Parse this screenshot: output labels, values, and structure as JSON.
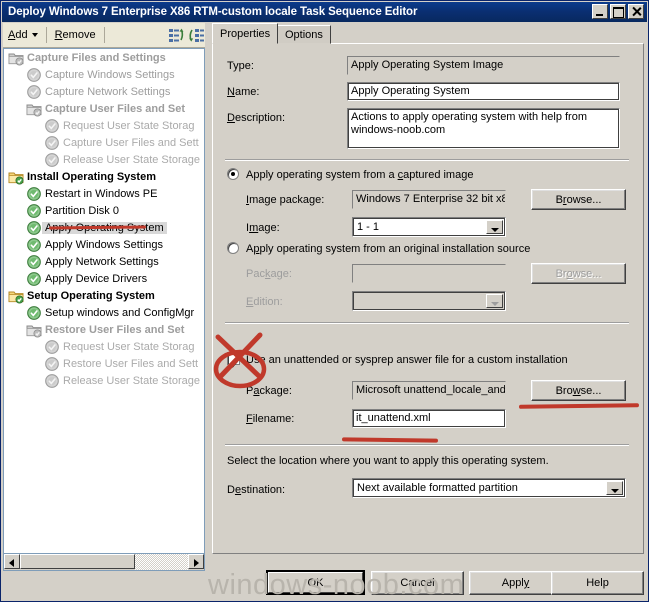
{
  "window": {
    "title": "Deploy Windows 7 Enterprise X86 RTM-custom locale Task Sequence Editor",
    "minimize_label": "Minimize",
    "maximize_label": "Maximize",
    "close_label": "Close"
  },
  "toolbar": {
    "add_label": "Add",
    "remove_label": "Remove",
    "move_up_icon": "move-up-icon",
    "move_down_icon": "move-down-icon"
  },
  "tree": {
    "items": [
      {
        "label": "Capture Files and Settings",
        "indent": 0,
        "icon": "folder-gray-icon",
        "style": "bold dim"
      },
      {
        "label": "Capture Windows Settings",
        "indent": 1,
        "icon": "step-gray-icon",
        "style": "dim"
      },
      {
        "label": "Capture Network Settings",
        "indent": 1,
        "icon": "step-gray-icon",
        "style": "dim"
      },
      {
        "label": "Capture User Files and Set",
        "indent": 1,
        "icon": "folder-gray-icon",
        "style": "bold dim"
      },
      {
        "label": "Request User State Storag",
        "indent": 2,
        "icon": "step-gray-icon",
        "style": "dim2"
      },
      {
        "label": "Capture User Files and Sett",
        "indent": 2,
        "icon": "step-gray-icon",
        "style": "dim2"
      },
      {
        "label": "Release User State Storage",
        "indent": 2,
        "icon": "step-gray-icon",
        "style": "dim2"
      },
      {
        "label": "Install Operating System",
        "indent": 0,
        "icon": "folder-yellow-icon",
        "style": "bold"
      },
      {
        "label": "Restart in Windows PE",
        "indent": 1,
        "icon": "step-green-icon",
        "style": ""
      },
      {
        "label": "Partition Disk 0",
        "indent": 1,
        "icon": "step-green-icon",
        "style": ""
      },
      {
        "label": "Apply Operating System",
        "indent": 1,
        "icon": "step-green-icon",
        "style": "sel"
      },
      {
        "label": "Apply Windows Settings",
        "indent": 1,
        "icon": "step-green-icon",
        "style": ""
      },
      {
        "label": "Apply Network Settings",
        "indent": 1,
        "icon": "step-green-icon",
        "style": ""
      },
      {
        "label": "Apply Device Drivers",
        "indent": 1,
        "icon": "step-green-icon",
        "style": ""
      },
      {
        "label": "Setup Operating System",
        "indent": 0,
        "icon": "folder-yellow-icon",
        "style": "bold"
      },
      {
        "label": "Setup windows and ConfigMgr",
        "indent": 1,
        "icon": "step-green-icon",
        "style": ""
      },
      {
        "label": "Restore User Files and Set",
        "indent": 1,
        "icon": "folder-gray-icon",
        "style": "bold dim"
      },
      {
        "label": "Request User State Storag",
        "indent": 2,
        "icon": "step-gray-icon",
        "style": "dim2"
      },
      {
        "label": "Restore User Files and Sett",
        "indent": 2,
        "icon": "step-gray-icon",
        "style": "dim2"
      },
      {
        "label": "Release User State Storage",
        "indent": 2,
        "icon": "step-gray-icon",
        "style": "dim2"
      }
    ]
  },
  "tabs": [
    {
      "label": "Properties",
      "active": true
    },
    {
      "label": "Options",
      "active": false
    }
  ],
  "properties": {
    "type_label": "Type:",
    "type_value": "Apply Operating System Image",
    "name_label": "Name:",
    "name_label_accel": "N",
    "name_value": "Apply Operating System",
    "description_label": "Description:",
    "description_value": "Actions to apply operating system with help from windows-noob.com",
    "radio_captured_label": "Apply operating system from a captured image",
    "radio_captured_selected": true,
    "image_package_label": "Image package:",
    "image_package_value": "Windows 7 Enterprise 32 bit x8",
    "image_package_browse": "Browse...",
    "image_label": "Image:",
    "image_value": "1 - 1",
    "radio_original_label": "Apply operating system from an original installation source",
    "radio_original_selected": false,
    "package_label": "Package:",
    "package_value": "",
    "package_browse": "Browse...",
    "edition_label": "Edition:",
    "edition_value": "",
    "unattend_checkbox_label": "Use an unattended or sysprep answer file for a custom installation",
    "unattend_checked": true,
    "unattend_package_label": "Package:",
    "unattend_package_value": "Microsoft unattend_locale_and",
    "unattend_package_browse": "Browse...",
    "filename_label": "Filename:",
    "filename_value": "it_unattend.xml",
    "destination_hint": "Select the location where you want to apply this operating system.",
    "destination_label": "Destination:",
    "destination_value": "Next available formatted partition"
  },
  "buttons": {
    "ok": "OK",
    "cancel": "Cancel",
    "apply": "Apply",
    "help": "Help"
  },
  "watermark": "windows-noob.com",
  "annotations": {
    "accent_color": "#c0392b",
    "cross_over_checkbox": "red-x-circle-annotation",
    "underline_apply_os": "red-underline-annotation",
    "underline_browse": "red-underline-annotation",
    "underline_filename": "red-underline-annotation"
  }
}
